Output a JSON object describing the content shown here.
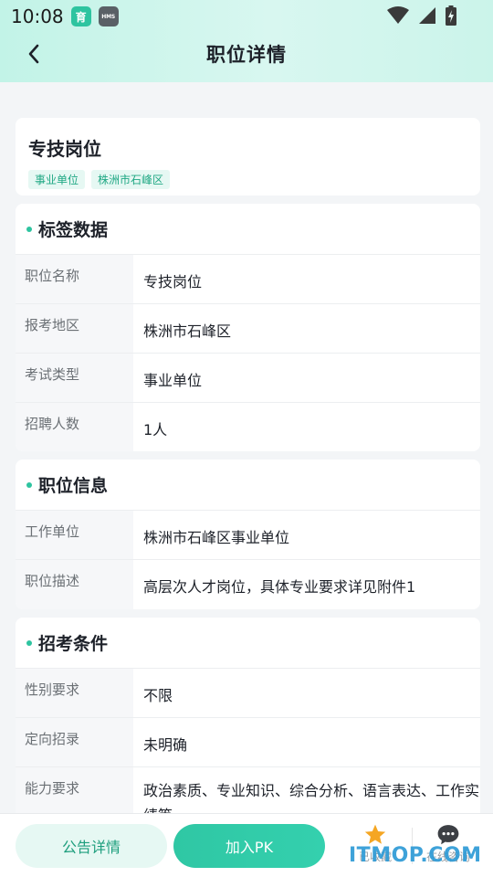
{
  "status": {
    "time": "10:08",
    "badge1": "育",
    "badge2": "HMS"
  },
  "header": {
    "title": "职位详情"
  },
  "job": {
    "name": "专技岗位",
    "tags": [
      "事业单位",
      "株洲市石峰区"
    ]
  },
  "sections": {
    "tag_data": {
      "title": "标签数据",
      "rows": [
        {
          "label": "职位名称",
          "value": "专技岗位"
        },
        {
          "label": "报考地区",
          "value": "株洲市石峰区"
        },
        {
          "label": "考试类型",
          "value": "事业单位"
        },
        {
          "label": "招聘人数",
          "value": "1人"
        }
      ]
    },
    "job_info": {
      "title": "职位信息",
      "rows": [
        {
          "label": "工作单位",
          "value": "株洲市石峰区事业单位"
        },
        {
          "label": "职位描述",
          "value": "高层次人才岗位，具体专业要求详见附件1"
        }
      ]
    },
    "conditions": {
      "title": "招考条件",
      "rows": [
        {
          "label": "性别要求",
          "value": "不限"
        },
        {
          "label": "定向招录",
          "value": "未明确"
        },
        {
          "label": "能力要求",
          "value": "政治素质、专业知识、综合分析、语言表达、工作实绩等"
        }
      ]
    }
  },
  "bottom": {
    "notice_btn": "公告详情",
    "pk_btn": "加入PK",
    "fav_label": "已收藏",
    "consult_label": "在线咨询"
  },
  "watermark": "ITMOP.COM",
  "colors": {
    "accent": "#2ec4a0",
    "star": "#f5a623"
  }
}
